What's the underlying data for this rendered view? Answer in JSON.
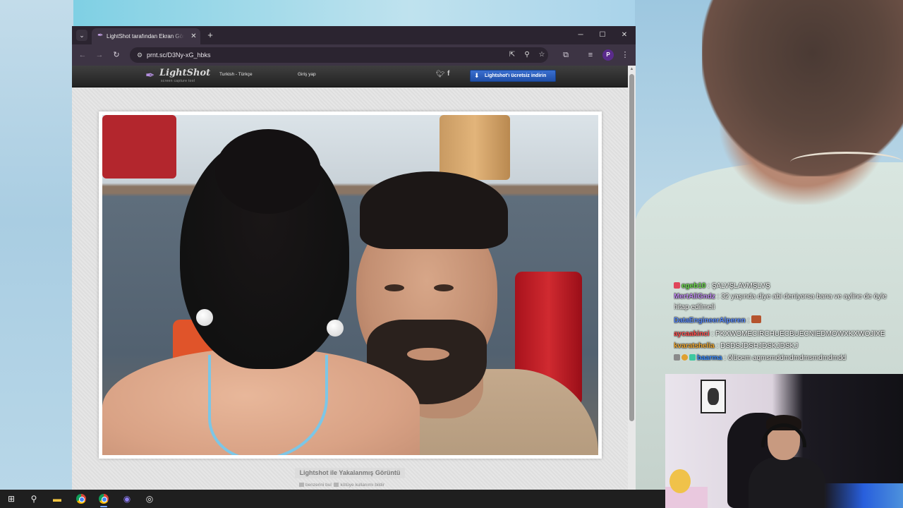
{
  "browser": {
    "tab": {
      "title": "LightShot tarafından Ekran Görüntüsü",
      "favicon": "feather-icon"
    },
    "url": "prnt.sc/D3Ny-xG_hbks",
    "profile_initial": "P",
    "window_controls": {
      "minimize": "─",
      "maximize": "☐",
      "close": "✕"
    }
  },
  "lightshot": {
    "logo": "LightShot",
    "tagline": "screen capture tool",
    "language": "Turkish - Türkçe",
    "login": "Giriş yap",
    "download_button": "Lightshot'ı ücretsiz indirin",
    "caption": "Lightshot ile Yakalanmış Görüntü",
    "links": [
      {
        "label": "benzerini bul"
      },
      {
        "label": "kötüye kullanımı bildir"
      }
    ]
  },
  "chat": [
    {
      "user": "egeb10",
      "color": "#6bdc4a",
      "message": "ŞALVŞLAVMŞLVŞ",
      "badge": "#e0455a"
    },
    {
      "user": "MertAliGndz",
      "color": "#c08cf0",
      "message": "32 yaşında diye abi deniyorsa bana ve ayline de öyle hitap edilmeli"
    },
    {
      "user": "DataEngineerAlperen",
      "color": "#5a8cff",
      "message": ""
    },
    {
      "user": "aycaakinci",
      "color": "#ff4d4d",
      "message": "PKXWOMECIRCHUECBUECNIEDMOWXKXWOJIXE"
    },
    {
      "user": "kvaratshelia",
      "color": "#f0a830",
      "message": "DSDSJDSHJDSKJDSKJ"
    },
    {
      "user": "baarma",
      "color": "#3a8cff",
      "message": "ölücem aqmsmddmdmdmsmdmdmdd"
    }
  ],
  "colors": {
    "accent_download": "#2a5fc0",
    "chrome_tab_bg": "#3d3444",
    "taskbar": "#1f1f1f"
  },
  "taskbar": {
    "icons": [
      "windows-start-icon",
      "search-icon",
      "file-explorer-icon",
      "chrome-icon",
      "chrome-icon",
      "discord-icon",
      "obs-icon"
    ]
  }
}
